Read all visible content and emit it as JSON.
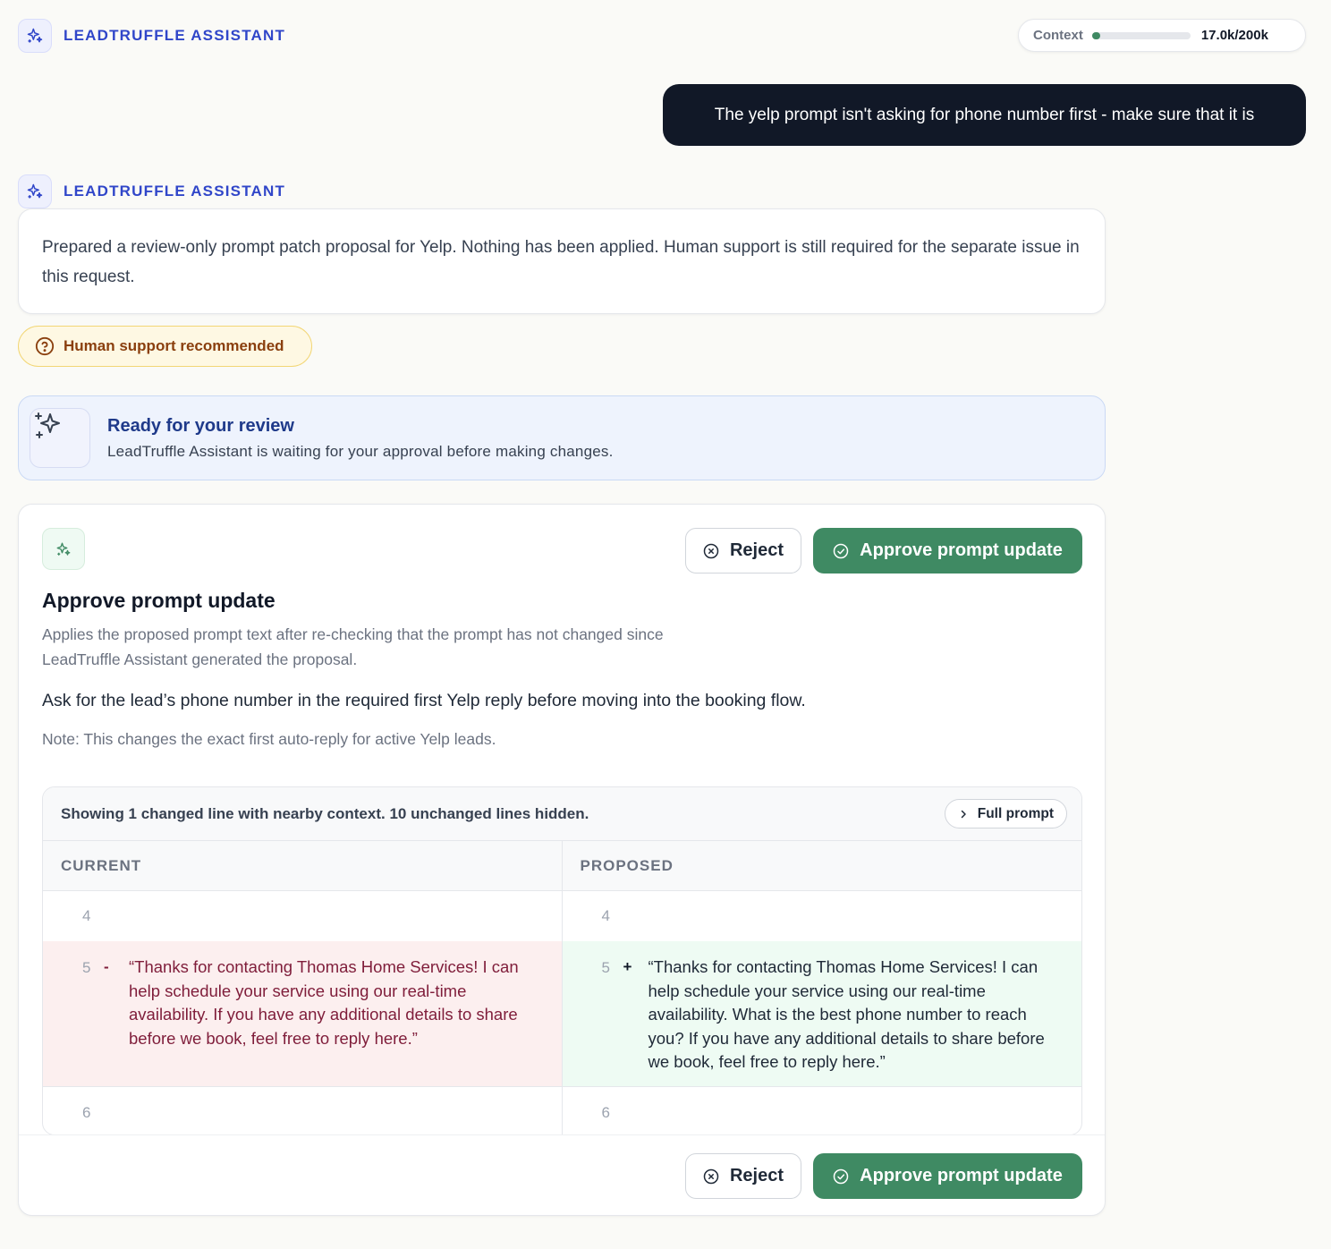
{
  "header": {
    "assistant_name": "LEADTRUFFLE ASSISTANT",
    "context": {
      "label": "Context",
      "value": "17.0k/200k",
      "used_fraction": 0.085
    }
  },
  "user_message": "The yelp prompt isn't asking for phone number first - make sure that it is",
  "assistant_message": {
    "name": "LEADTRUFFLE ASSISTANT",
    "text": "Prepared a review-only prompt patch proposal for Yelp. Nothing has been applied. Human support is still required for the separate issue in this request."
  },
  "support_badge": "Human support recommended",
  "review_banner": {
    "title": "Ready for your review",
    "subtitle": "LeadTruffle Assistant is waiting for your approval before making changes."
  },
  "approval": {
    "reject_label": "Reject",
    "approve_label": "Approve prompt update",
    "title": "Approve prompt update",
    "description": "Applies the proposed prompt text after re-checking that the prompt has not changed since LeadTruffle Assistant generated the proposal.",
    "summary": "Ask for the lead’s phone number in the required first Yelp reply before moving into the booking flow.",
    "note": "Note: This changes the exact first auto-reply for active Yelp leads."
  },
  "diff": {
    "header_text": "Showing 1 changed line with nearby context. 10 unchanged lines hidden.",
    "full_prompt_label": "Full prompt",
    "current_label": "CURRENT",
    "proposed_label": "PROPOSED",
    "rows": [
      {
        "left_line": "4",
        "right_line": "4"
      },
      {
        "left_line": "5",
        "left_sign": "-",
        "left_text": "“Thanks for contacting Thomas Home Services! I can help schedule your service using our real-time availability. If you have any additional details to share before we book, feel free to reply here.”",
        "right_line": "5",
        "right_sign": "+",
        "right_text": "“Thanks for contacting Thomas Home Services! I can help schedule your service using our real-time availability. What is the best phone number to reach you? If you have any additional details to share before we book, feel free to reply here.”"
      },
      {
        "left_line": "6",
        "right_line": "6"
      }
    ]
  },
  "colors": {
    "accent_blue": "#3046c9",
    "approve_green": "#3f8a63",
    "deleted_bg": "#fcefef",
    "added_bg": "#eefbf3",
    "warning_bg": "#fef8e3"
  }
}
